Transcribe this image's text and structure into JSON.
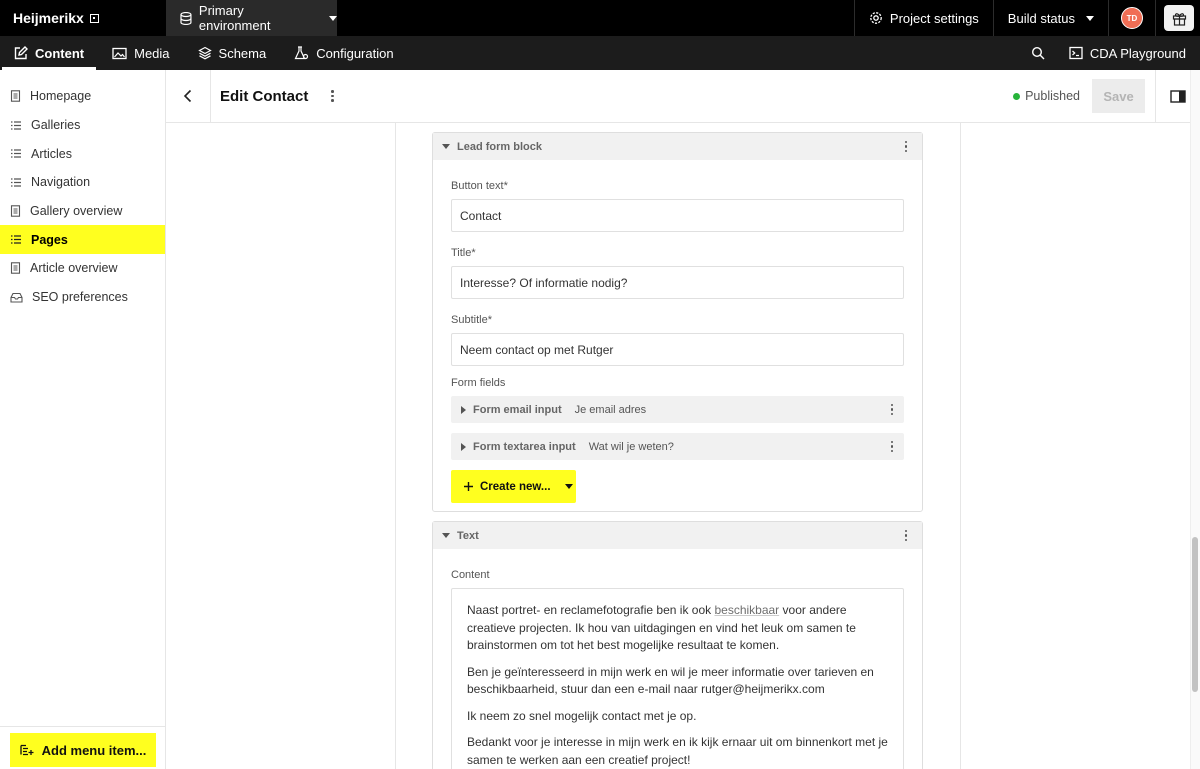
{
  "topbar": {
    "brand": "Heijmerikx",
    "environment": "Primary environment",
    "project_settings": "Project settings",
    "build_status": "Build status",
    "avatar_initials": "TD"
  },
  "nav": {
    "tabs": [
      {
        "label": "Content",
        "icon": "pencil-icon",
        "active": true
      },
      {
        "label": "Media",
        "icon": "image-icon"
      },
      {
        "label": "Schema",
        "icon": "layers-icon"
      },
      {
        "label": "Configuration",
        "icon": "flask-gear-icon"
      }
    ],
    "cda_playground": "CDA Playground"
  },
  "sidebar": {
    "items": [
      {
        "label": "Homepage",
        "icon": "document-icon"
      },
      {
        "label": "Galleries",
        "icon": "list-icon"
      },
      {
        "label": "Articles",
        "icon": "list-icon"
      },
      {
        "label": "Navigation",
        "icon": "list-icon"
      },
      {
        "label": "Gallery overview",
        "icon": "document-icon"
      },
      {
        "label": "Pages",
        "icon": "list-icon",
        "active": true
      },
      {
        "label": "Article overview",
        "icon": "document-icon"
      },
      {
        "label": "SEO preferences",
        "icon": "settings-tray-icon"
      }
    ],
    "add_menu_item": "Add menu item..."
  },
  "header": {
    "title": "Edit Contact",
    "status": "Published",
    "save": "Save"
  },
  "lead_form_block": {
    "heading": "Lead form block",
    "button_text_label": "Button text*",
    "button_text_value": "Contact",
    "title_label": "Title*",
    "title_value": "Interesse? Of informatie nodig?",
    "subtitle_label": "Subtitle*",
    "subtitle_value": "Neem contact op met Rutger",
    "form_fields_label": "Form fields",
    "form_fields": [
      {
        "type": "Form email input",
        "value": "Je email adres"
      },
      {
        "type": "Form textarea input",
        "value": "Wat wil je weten?"
      }
    ],
    "create_new": "Create new..."
  },
  "text_block": {
    "heading": "Text",
    "content_label": "Content",
    "p1_before": "Naast portret- en reclamefotografie ben ik ook ",
    "p1_link": "beschikbaar",
    "p1_after": " voor andere creatieve projecten. Ik hou van uitdagingen en vind het leuk om samen te brainstormen om tot het best mogelijke resultaat te komen.",
    "p2": "Ben je geïnteresseerd in mijn werk en wil je meer informatie over tarieven en beschikbaarheid, stuur dan een e-mail naar rutger@heijmerikx.com",
    "p3": "Ik neem zo snel mogelijk contact met je op.",
    "p4": "Bedankt voor je interesse in mijn werk en ik kijk ernaar uit om binnenkort met je samen te werken aan een creatief project!"
  },
  "colors": {
    "accent": "#ffff1f",
    "topbar": "#000000",
    "published": "#27b43a",
    "avatar": "#f06e55"
  }
}
